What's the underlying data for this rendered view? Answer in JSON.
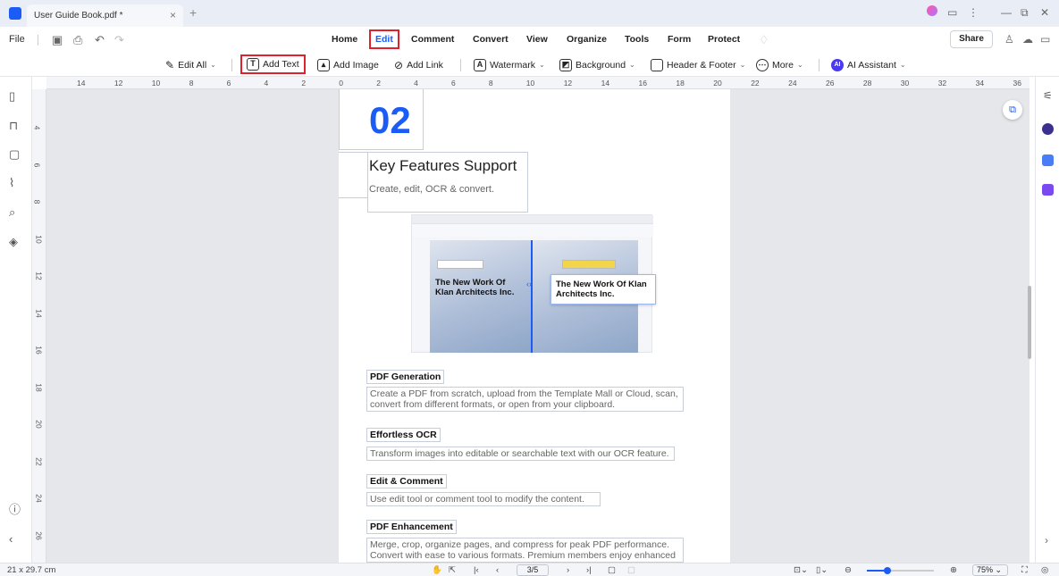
{
  "titlebar": {
    "doc_tab": "User Guide Book.pdf *",
    "close": "×",
    "new_tab": "+"
  },
  "menubar": {
    "file": "File",
    "tabs": [
      "Home",
      "Edit",
      "Comment",
      "Convert",
      "View",
      "Organize",
      "Tools",
      "Form",
      "Protect"
    ],
    "active_tab": "Edit",
    "share": "Share"
  },
  "toolbar": {
    "edit_all": "Edit All",
    "add_text": "Add Text",
    "add_image": "Add Image",
    "add_link": "Add Link",
    "watermark": "Watermark",
    "background": "Background",
    "header_footer": "Header & Footer",
    "more": "More",
    "ai_assistant": "AI Assistant"
  },
  "ruler": {
    "h_ticks": [
      "14",
      "12",
      "10",
      "8",
      "6",
      "4",
      "2",
      "0",
      "2",
      "4",
      "6",
      "8",
      "10",
      "12",
      "14",
      "16",
      "18",
      "20",
      "22",
      "24",
      "26",
      "28",
      "30",
      "32",
      "34",
      "36"
    ],
    "v_ticks": [
      "4",
      "6",
      "8",
      "10",
      "12",
      "14",
      "16",
      "18",
      "20",
      "22",
      "24",
      "26"
    ]
  },
  "page": {
    "number": "02",
    "title": "Key Features Support",
    "subtitle": "Create, edit, OCR & convert.",
    "screenshot_left_text": "The New Work Of Klan Architects Inc.",
    "screenshot_right_text": "The New Work Of Klan Architects Inc.",
    "features": [
      {
        "heading": "PDF Generation",
        "desc": "Create a PDF from scratch, upload from the Template Mall or Cloud, scan, convert from different formats, or open from your clipboard."
      },
      {
        "heading": "Effortless OCR",
        "desc": "Transform images into editable or searchable text with our OCR feature."
      },
      {
        "heading": "Edit & Comment",
        "desc": "Use edit tool or comment tool to modify the content."
      },
      {
        "heading": "PDF Enhancement",
        "desc": "Merge, crop, organize pages, and compress for peak PDF performance. Convert with ease to various formats. Premium members enjoy enhanced"
      }
    ]
  },
  "statusbar": {
    "page_size": "21 x 29.7 cm",
    "page_indicator": "3/5",
    "zoom": "75%",
    "zoom_level": 0.3
  },
  "colors": {
    "accent": "#1a5cf5",
    "highlight": "#e0202b"
  }
}
